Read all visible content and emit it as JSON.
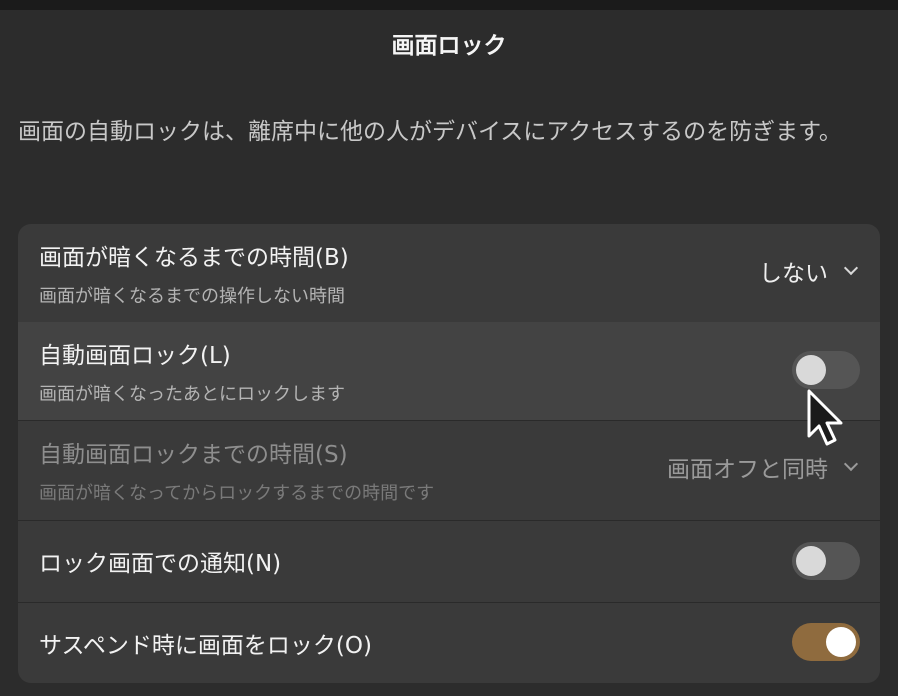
{
  "dialog": {
    "title": "画面ロック",
    "description": "画面の自動ロックは、離席中に他の人がデバイスにアクセスするのを防ぎます。"
  },
  "settings": {
    "blank_delay": {
      "title": "画面が暗くなるまでの時間(B)",
      "subtitle": "画面が暗くなるまでの操作しない時間",
      "value": "しない"
    },
    "auto_lock": {
      "title": "自動画面ロック(L)",
      "subtitle": "画面が暗くなったあとにロックします",
      "state": "off"
    },
    "lock_delay": {
      "title": "自動画面ロックまでの時間(S)",
      "subtitle": "画面が暗くなってからロックするまでの時間です",
      "value": "画面オフと同時"
    },
    "lock_notifications": {
      "title": "ロック画面での通知(N)",
      "state": "off"
    },
    "lock_on_suspend": {
      "title": "サスペンド時に画面をロック(O)",
      "state": "on"
    }
  },
  "colors": {
    "background": "#2c2c2c",
    "card": "#3a3a3a",
    "switch_on": "#8f6b3e",
    "switch_off": "#555555"
  },
  "icons": {
    "dropdown": "chevron-down-icon",
    "pointer": "mouse-cursor-icon"
  }
}
